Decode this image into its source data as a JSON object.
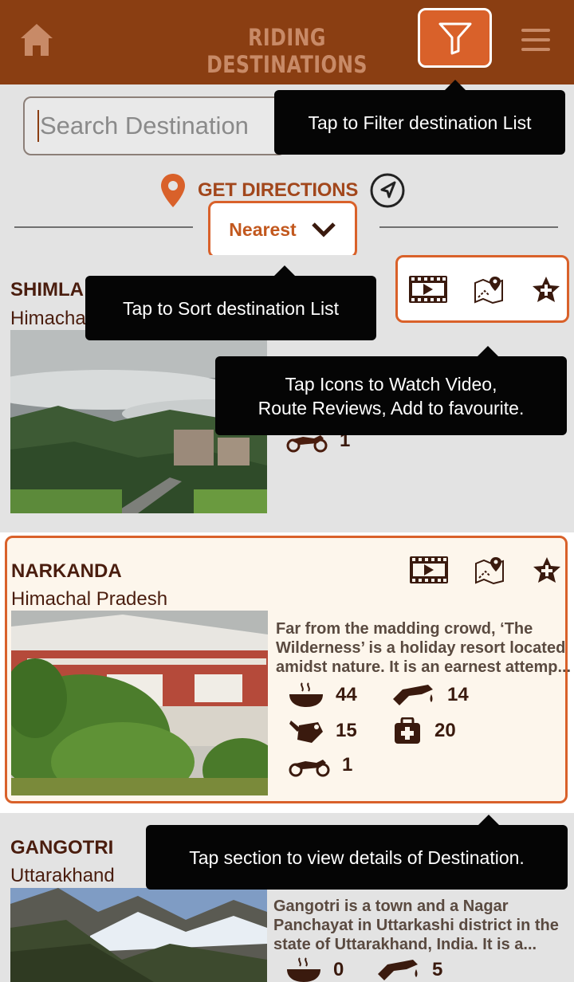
{
  "header": {
    "title": "RIDING DESTINATIONS",
    "home_icon": "home-icon",
    "filter_icon": "filter-icon",
    "menu_icon": "hamburger-menu-icon",
    "background": "#8a3e12",
    "accent": "#d9612a"
  },
  "search": {
    "placeholder": "Search Destination"
  },
  "directions": {
    "label": "GET DIRECTIONS"
  },
  "sort": {
    "label": "Nearest"
  },
  "tooltips": {
    "filter": "Tap to Filter destination List",
    "sort": "Tap to Sort destination List",
    "icons_line1": "Tap Icons to Watch Video,",
    "icons_line2": "Route Reviews, Add to favourite.",
    "section": "Tap section to view details of Destination."
  },
  "destinations": [
    {
      "name": "SHIMLA",
      "state": "Himachal Pradesh",
      "bikers": "1"
    },
    {
      "name": "NARKANDA",
      "state": "Himachal Pradesh",
      "description": "Far from the madding crowd, ‘The Wilderness’ is a holiday resort located amidst nature. It is an earnest attemp...",
      "food": "44",
      "fuel": "14",
      "repair": "15",
      "medical": "20",
      "bikers": "1"
    },
    {
      "name": "GANGOTRI",
      "state": "Uttarakhand",
      "description": "Gangotri is a town and a Nagar Panchayat in Uttarkashi district in the state of Uttarakhand, India. It is a...",
      "food": "0",
      "fuel": "5"
    }
  ]
}
